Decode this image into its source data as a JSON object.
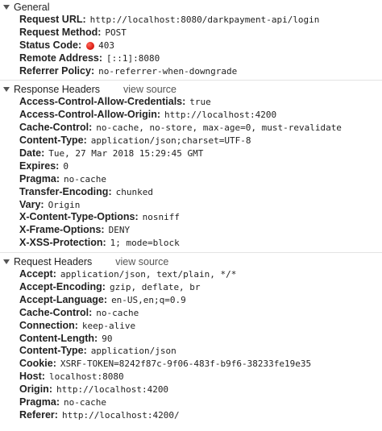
{
  "general": {
    "title": "General",
    "rows": [
      {
        "key": "Request URL",
        "value": "http://localhost:8080/darkpayment-api/login"
      },
      {
        "key": "Request Method",
        "value": "POST"
      },
      {
        "key": "Status Code",
        "value": "403",
        "status_color": "#e0241a"
      },
      {
        "key": "Remote Address",
        "value": "[::1]:8080"
      },
      {
        "key": "Referrer Policy",
        "value": "no-referrer-when-downgrade"
      }
    ]
  },
  "response_headers": {
    "title": "Response Headers",
    "view_source": "view source",
    "rows": [
      {
        "key": "Access-Control-Allow-Credentials",
        "value": "true"
      },
      {
        "key": "Access-Control-Allow-Origin",
        "value": "http://localhost:4200"
      },
      {
        "key": "Cache-Control",
        "value": "no-cache, no-store, max-age=0, must-revalidate"
      },
      {
        "key": "Content-Type",
        "value": "application/json;charset=UTF-8"
      },
      {
        "key": "Date",
        "value": "Tue, 27 Mar 2018 15:29:45 GMT"
      },
      {
        "key": "Expires",
        "value": "0"
      },
      {
        "key": "Pragma",
        "value": "no-cache"
      },
      {
        "key": "Transfer-Encoding",
        "value": "chunked"
      },
      {
        "key": "Vary",
        "value": "Origin"
      },
      {
        "key": "X-Content-Type-Options",
        "value": "nosniff"
      },
      {
        "key": "X-Frame-Options",
        "value": "DENY"
      },
      {
        "key": "X-XSS-Protection",
        "value": "1; mode=block"
      }
    ]
  },
  "request_headers": {
    "title": "Request Headers",
    "view_source": "view source",
    "rows": [
      {
        "key": "Accept",
        "value": "application/json, text/plain, */*"
      },
      {
        "key": "Accept-Encoding",
        "value": "gzip, deflate, br"
      },
      {
        "key": "Accept-Language",
        "value": "en-US,en;q=0.9"
      },
      {
        "key": "Cache-Control",
        "value": "no-cache"
      },
      {
        "key": "Connection",
        "value": "keep-alive"
      },
      {
        "key": "Content-Length",
        "value": "90"
      },
      {
        "key": "Content-Type",
        "value": "application/json"
      },
      {
        "key": "Cookie",
        "value": "XSRF-TOKEN=8242f87c-9f06-483f-b9f6-38233fe19e35"
      },
      {
        "key": "Host",
        "value": "localhost:8080"
      },
      {
        "key": "Origin",
        "value": "http://localhost:4200"
      },
      {
        "key": "Pragma",
        "value": "no-cache"
      },
      {
        "key": "Referer",
        "value": "http://localhost:4200/"
      }
    ]
  }
}
